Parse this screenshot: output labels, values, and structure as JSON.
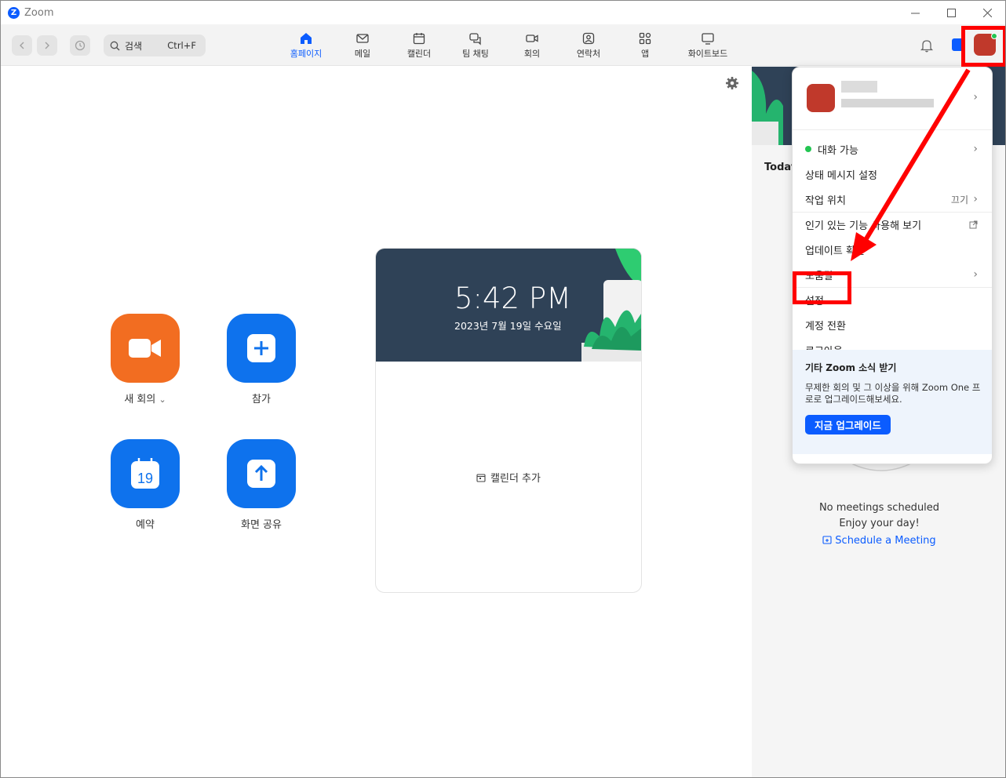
{
  "window": {
    "title": "Zoom",
    "logo_letter": "Z"
  },
  "toolbar": {
    "search_label": "검색",
    "search_shortcut": "Ctrl+F",
    "tabs": [
      {
        "label": "홈페이지",
        "icon": "home-icon"
      },
      {
        "label": "메일",
        "icon": "mail-icon"
      },
      {
        "label": "캘린더",
        "icon": "calendar-icon"
      },
      {
        "label": "팀 채팅",
        "icon": "chat-icon"
      },
      {
        "label": "회의",
        "icon": "video-icon"
      },
      {
        "label": "연락처",
        "icon": "contacts-icon"
      },
      {
        "label": "앱",
        "icon": "apps-icon"
      },
      {
        "label": "화이트보드",
        "icon": "whiteboard-icon"
      }
    ],
    "active_tab": "홈페이지",
    "avatar_tooltip": "대화"
  },
  "actions": {
    "new_meeting": "새 회의",
    "new_meeting_caret": "⌄",
    "join": "참가",
    "schedule": "예약",
    "calendar_day": "19",
    "share_screen": "화면 공유"
  },
  "clock_card": {
    "time": "5:42 PM",
    "date": "2023년 7월 19일 수요일",
    "add_calendar": "캘린더 추가"
  },
  "right_panel": {
    "today_label": "Today",
    "no_meetings": "No meetings scheduled",
    "enjoy": "Enjoy your day!",
    "schedule_link": "Schedule a Meeting"
  },
  "profile_menu": {
    "status": "대화 가능",
    "status_message": "상태 메시지 설정",
    "work_location": "작업 위치",
    "work_location_value": "끄기",
    "try_features": "인기 있는 기능 사용해 보기",
    "check_updates": "업데이트 확인",
    "help": "도움말",
    "settings": "설정",
    "switch_account": "계정 전환",
    "sign_out": "로그아웃",
    "upsell_title": "기타 Zoom 소식 받기",
    "upsell_body": "무제한 회의 및 그 이상을 위해 Zoom One 프로로 업그레이드해보세요.",
    "upsell_button": "지금 업그레이드"
  },
  "colors": {
    "accent": "#0b5cff",
    "annotation": "#ff0000",
    "orange_tile": "#f26d21",
    "blue_tile": "#0e72ed",
    "status_green": "#23c552"
  }
}
